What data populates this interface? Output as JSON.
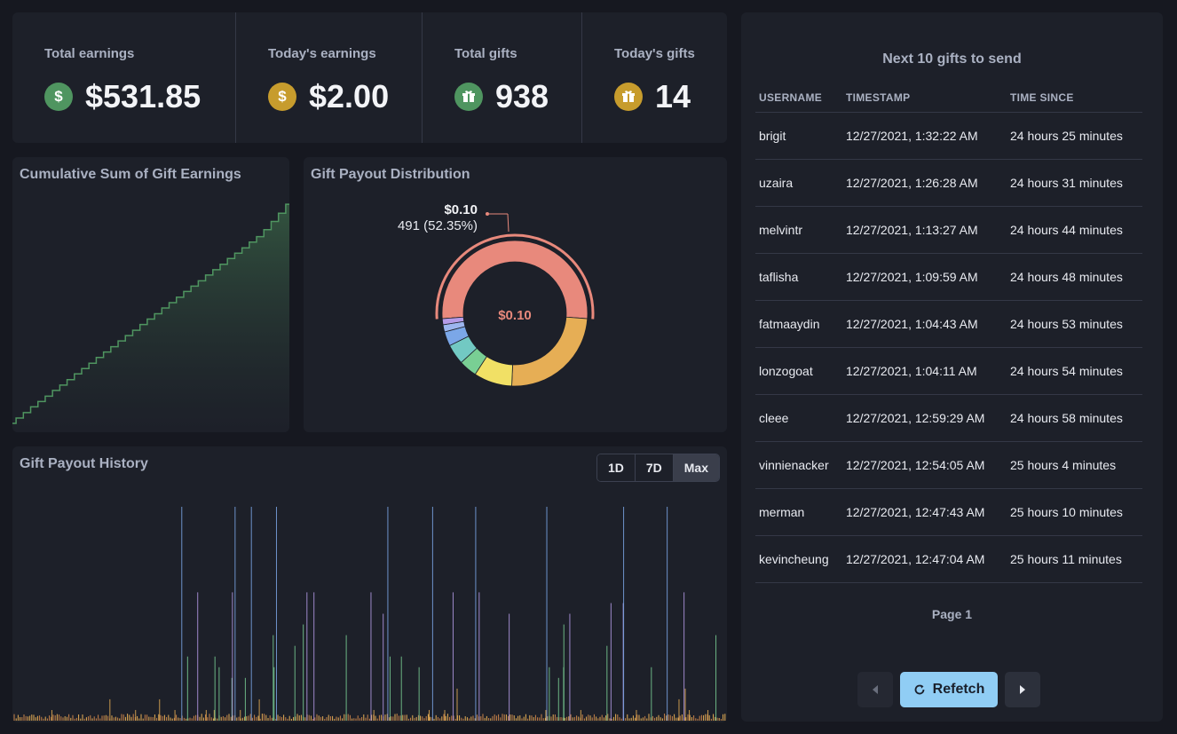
{
  "stats": [
    {
      "label": "Total earnings",
      "value": "$531.85",
      "icon": "dollar-icon",
      "icon_glyph": "$",
      "tone": "green"
    },
    {
      "label": "Today's earnings",
      "value": "$2.00",
      "icon": "dollar-icon",
      "icon_glyph": "$",
      "tone": "gold"
    },
    {
      "label": "Total gifts",
      "value": "938",
      "icon": "gift-icon",
      "icon_glyph": "gift",
      "tone": "green"
    },
    {
      "label": "Today's gifts",
      "value": "14",
      "icon": "gift-icon",
      "icon_glyph": "gift",
      "tone": "gold"
    }
  ],
  "colors": {
    "background": "#161820",
    "card": "#1d2029",
    "green": "#4f9560",
    "gold": "#c79c2d",
    "accent": "#90cdf4"
  },
  "cumulative": {
    "title": "Cumulative Sum of Gift Earnings"
  },
  "distribution": {
    "title": "Gift Payout Distribution",
    "center_label": "$0.10",
    "tooltip_value": "$0.10",
    "tooltip_detail": "491 (52.35%)"
  },
  "history": {
    "title": "Gift Payout History",
    "ranges": [
      "1D",
      "7D",
      "Max"
    ],
    "active_range": "Max"
  },
  "queue": {
    "title": "Next 10 gifts to send",
    "columns": [
      "USERNAME",
      "TIMESTAMP",
      "TIME SINCE"
    ],
    "rows": [
      [
        "brigit",
        "12/27/2021, 1:32:22 AM",
        "24 hours 25 minutes"
      ],
      [
        "uzaira",
        "12/27/2021, 1:26:28 AM",
        "24 hours 31 minutes"
      ],
      [
        "melvintr",
        "12/27/2021, 1:13:27 AM",
        "24 hours 44 minutes"
      ],
      [
        "taflisha",
        "12/27/2021, 1:09:59 AM",
        "24 hours 48 minutes"
      ],
      [
        "fatmaaydin",
        "12/27/2021, 1:04:43 AM",
        "24 hours 53 minutes"
      ],
      [
        "lonzogoat",
        "12/27/2021, 1:04:11 AM",
        "24 hours 54 minutes"
      ],
      [
        "cleee",
        "12/27/2021, 12:59:29 AM",
        "24 hours 58 minutes"
      ],
      [
        "vinnienacker",
        "12/27/2021, 12:54:05 AM",
        "25 hours 4 minutes"
      ],
      [
        "merman",
        "12/27/2021, 12:47:43 AM",
        "25 hours 10 minutes"
      ],
      [
        "kevincheung",
        "12/27/2021, 12:47:04 AM",
        "25 hours 11 minutes"
      ]
    ],
    "page_label": "Page 1",
    "refetch_label": "Refetch",
    "prev_icon": "chevron-left-icon",
    "next_icon": "chevron-right-icon",
    "refetch_icon": "refresh-icon"
  },
  "chart_data": [
    {
      "type": "area",
      "title": "Cumulative Sum of Gift Earnings",
      "series_color": "#4f9560",
      "values": [
        0,
        13,
        26,
        40,
        53,
        66,
        80,
        93,
        106,
        120,
        133,
        146,
        160,
        173,
        186,
        200,
        213,
        226,
        240,
        253,
        266,
        280,
        293,
        306,
        320,
        333,
        346,
        360,
        373,
        386,
        400,
        413,
        426,
        440,
        453,
        470,
        490,
        510,
        531.85
      ],
      "ylim": [
        0,
        560
      ],
      "grid": false,
      "legend": "none"
    },
    {
      "type": "pie",
      "title": "Gift Payout Distribution",
      "slices": [
        {
          "label": "$0.10",
          "value": 52.35,
          "color": "#e8897c"
        },
        {
          "label": "",
          "value": 24.5,
          "color": "#e6ae55"
        },
        {
          "label": "",
          "value": 8.5,
          "color": "#f1e065"
        },
        {
          "label": "",
          "value": 4.0,
          "color": "#79cf94"
        },
        {
          "label": "",
          "value": 4.5,
          "color": "#72c9c3"
        },
        {
          "label": "",
          "value": 3.2,
          "color": "#7ba7e8"
        },
        {
          "label": "",
          "value": 1.6,
          "color": "#9cb5ef"
        },
        {
          "label": "",
          "value": 1.35,
          "color": "#b59be8"
        }
      ],
      "highlighted": "$0.10"
    },
    {
      "type": "bar",
      "title": "Gift Payout History",
      "series": [
        {
          "color": "#e6ae55",
          "values": [
            0.1,
            0.1,
            0.2,
            0.1,
            0.1,
            0.3,
            0.1,
            0.1,
            0.2,
            0.1,
            0.1,
            0.1,
            0.2,
            0.1,
            0.3,
            0.1,
            0.1,
            0.2,
            0.1,
            0.1
          ]
        },
        {
          "color": "#79cf94",
          "values": [
            0.5,
            0.8,
            0.4,
            0.6,
            0.9,
            0.5,
            0.7,
            0.5,
            0.8,
            0.4,
            0.6,
            0.5,
            0.9,
            0.6,
            0.4,
            0.7,
            0.5,
            0.6,
            0.8,
            0.5
          ]
        },
        {
          "color": "#b59be8",
          "values": [
            1.2,
            1.0,
            1.2,
            1.1,
            1.2,
            1.0,
            1.2,
            1.2,
            1.1,
            1.2,
            1.0,
            1.2,
            1.2
          ]
        },
        {
          "color": "#7ba7e8",
          "values": [
            2.0,
            2.0,
            2.0,
            2.0,
            2.0,
            2.0,
            2.0,
            2.0,
            2.0,
            2.0
          ]
        }
      ],
      "ylim": [
        0,
        2.1
      ]
    }
  ]
}
